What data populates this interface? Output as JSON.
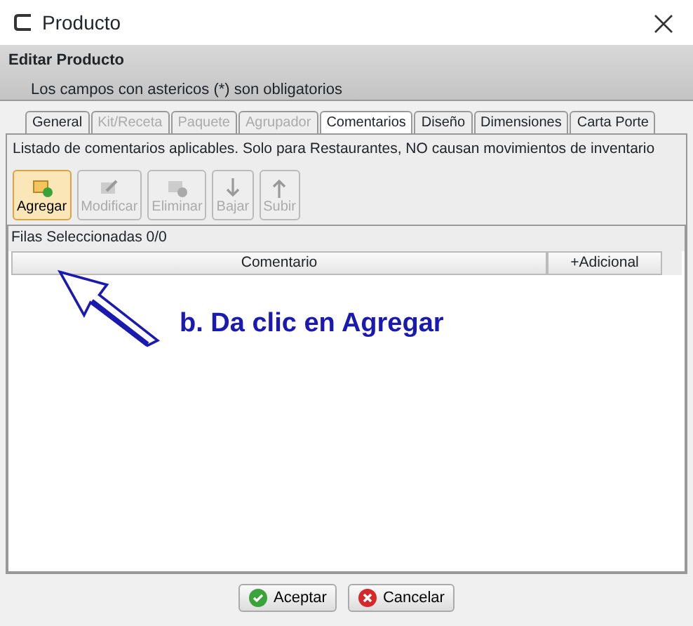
{
  "window": {
    "title": "Producto"
  },
  "header": {
    "title": "Editar Producto",
    "subtitle": "Los campos con astericos (*) son obligatorios"
  },
  "tabs": [
    {
      "label": "General",
      "selected": false,
      "disabled": false
    },
    {
      "label": "Kit/Receta",
      "selected": false,
      "disabled": true
    },
    {
      "label": "Paquete",
      "selected": false,
      "disabled": true
    },
    {
      "label": "Agrupador",
      "selected": false,
      "disabled": true
    },
    {
      "label": "Comentarios",
      "selected": true,
      "disabled": false
    },
    {
      "label": "Diseño",
      "selected": false,
      "disabled": false
    },
    {
      "label": "Dimensiones",
      "selected": false,
      "disabled": false
    },
    {
      "label": "Carta Porte",
      "selected": false,
      "disabled": false
    }
  ],
  "description": "Listado de comentarios aplicables. Solo para Restaurantes, NO causan movimientos de inventario",
  "toolbar": [
    {
      "label": "Agregar",
      "kind": "add",
      "disabled": false,
      "highlighted": true
    },
    {
      "label": "Modificar",
      "kind": "edit",
      "disabled": true,
      "highlighted": false
    },
    {
      "label": "Eliminar",
      "kind": "delete",
      "disabled": true,
      "highlighted": false
    },
    {
      "label": "Bajar",
      "kind": "down",
      "disabled": true,
      "highlighted": false
    },
    {
      "label": "Subir",
      "kind": "up",
      "disabled": true,
      "highlighted": false
    }
  ],
  "selected_rows": {
    "label": "Filas Seleccionadas",
    "count": "0/0"
  },
  "table": {
    "columns": [
      "Comentario",
      "+Adicional"
    ]
  },
  "annotation": {
    "text": "b. Da clic en Agregar"
  },
  "buttons": [
    {
      "label": "Aceptar",
      "kind": "ok"
    },
    {
      "label": "Cancelar",
      "kind": "cancel"
    }
  ]
}
